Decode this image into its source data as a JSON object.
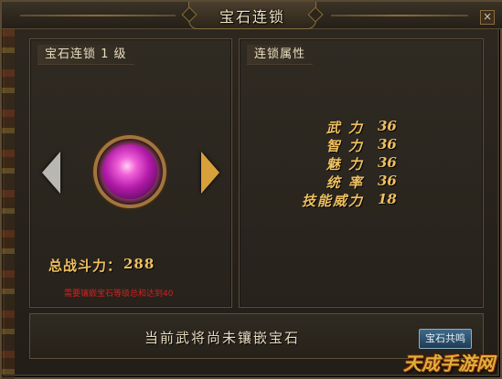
{
  "window": {
    "title": "宝石连锁",
    "close_label": "×"
  },
  "left_panel": {
    "heading": "宝石连锁 1 级",
    "power_label": "总战斗力：",
    "power_value": "288",
    "hint": "需要镶嵌宝石等级总和达到40"
  },
  "right_panel": {
    "heading": "连锁属性",
    "attributes": [
      {
        "name": "武 力",
        "value": "36"
      },
      {
        "name": "智 力",
        "value": "36"
      },
      {
        "name": "魅 力",
        "value": "36"
      },
      {
        "name": "统 率",
        "value": "36"
      },
      {
        "name": "技能威力",
        "value": "18"
      }
    ]
  },
  "bottom_bar": {
    "status": "当前武将尚未镶嵌宝石",
    "resonance_button": "宝石共鸣"
  },
  "watermark": "天成手游网",
  "colors": {
    "gold_text": "#f0c060",
    "gem": "#d040c8",
    "hint_red": "#d02020"
  }
}
